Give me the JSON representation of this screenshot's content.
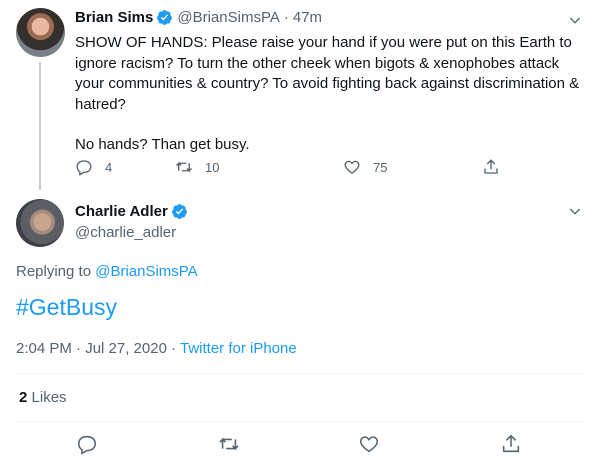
{
  "parent_tweet": {
    "author_name": "Brian Sims",
    "handle": "@BrianSimsPA",
    "separator": "·",
    "time": "47m",
    "text_line1": "SHOW OF HANDS: Please raise your hand if you were put on this Earth to ignore racism? To turn the other cheek when bigots & xenophobes attack your communities & country? To avoid fighting back against discrimination & hatred?",
    "text_line2": "No hands? Than get busy.",
    "reply_count": "4",
    "retweet_count": "10",
    "like_count": "75"
  },
  "main_tweet": {
    "author_name": "Charlie Adler",
    "handle": "@charlie_adler",
    "replying_prefix": "Replying to",
    "replying_to": "@BrianSimsPA",
    "hashtag": "#GetBusy",
    "timestamp": "2:04 PM · Jul 27, 2020 · ",
    "source": "Twitter for iPhone",
    "likes_count": "2",
    "likes_label": "Likes"
  },
  "colors": {
    "accent": "#1d9bf0",
    "text": "#0f1419",
    "secondary": "#536471",
    "divider": "#eff3f4"
  },
  "icons": [
    "avatar",
    "verified-badge-icon",
    "chevron-down-icon",
    "reply-icon",
    "retweet-icon",
    "like-icon",
    "share-icon"
  ]
}
